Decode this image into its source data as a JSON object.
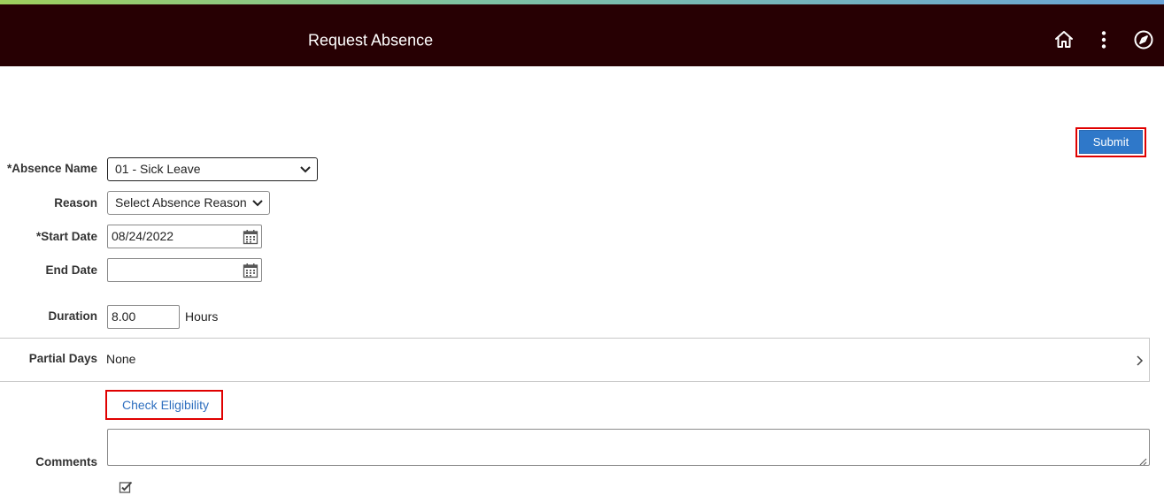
{
  "header": {
    "title": "Request Absence",
    "icons": [
      "home-icon",
      "actions-menu-icon",
      "navbar-compass-icon"
    ],
    "background_color": "#270003"
  },
  "toolbar": {
    "submit_label": "Submit"
  },
  "form": {
    "absence_name": {
      "required_mark": "*",
      "label": "Absence Name",
      "value": "01 - Sick Leave"
    },
    "reason": {
      "label": "Reason",
      "value": "Select Absence Reason"
    },
    "start_date": {
      "required_mark": "*",
      "label": "Start Date",
      "value": "08/24/2022"
    },
    "end_date": {
      "label": "End Date",
      "value": ""
    },
    "duration": {
      "label": "Duration",
      "value": "8.00",
      "unit": "Hours"
    },
    "partial_days": {
      "label": "Partial Days",
      "value": "None"
    },
    "check_eligibility_label": "Check Eligibility",
    "comments": {
      "label": "Comments",
      "value": ""
    }
  },
  "colors": {
    "accent_button": "#2f78c9",
    "highlight_frame": "#e00000",
    "link": "#2f6fbf"
  }
}
